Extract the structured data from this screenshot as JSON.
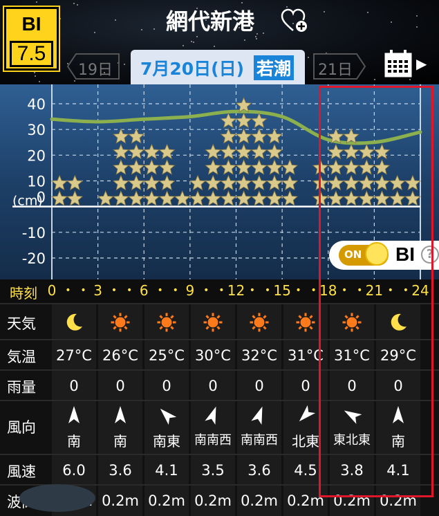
{
  "header": {
    "bi_label": "BI",
    "bi_value": "7.5",
    "title": "網代新港",
    "favorite_icon": "heart-plus-icon",
    "prev_day": "19日",
    "current_date": "7月20日(日)",
    "tide_type": "若潮",
    "next_day": "21日",
    "calendar_icon": "calendar-icon"
  },
  "chart_data": {
    "type": "line",
    "x": [
      0,
      3,
      6,
      9,
      12,
      15,
      18,
      21,
      24
    ],
    "series": [
      {
        "values": [
          34,
          33,
          34,
          35,
          37,
          35,
          26,
          25,
          29
        ]
      }
    ],
    "y_ticks": [
      "40",
      "30",
      "20",
      "10",
      "0",
      "-10",
      "-20"
    ],
    "y_unit": "(cm)",
    "ylim": [
      -25,
      45
    ],
    "xlim": [
      0,
      24
    ],
    "bi_stars": [
      2,
      2,
      0,
      1,
      5,
      5,
      4,
      4,
      1,
      2,
      4,
      6,
      7,
      6,
      5,
      3,
      0,
      3,
      5,
      5,
      4,
      4,
      2,
      2
    ],
    "grid": true
  },
  "bi_toggle": {
    "state": "ON",
    "label": "BI",
    "help": "?"
  },
  "hours": {
    "label": "時刻",
    "ticks": [
      "0",
      "3",
      "6",
      "9",
      "12",
      "15",
      "18",
      "21",
      "24"
    ]
  },
  "table": {
    "weather": {
      "label": "天気",
      "icons": [
        "moon",
        "sun",
        "sun",
        "sun",
        "sun",
        "sun",
        "sun",
        "moon"
      ]
    },
    "temp": {
      "label": "気温",
      "values": [
        "27°C",
        "26°C",
        "25°C",
        "30°C",
        "32°C",
        "31°C",
        "31°C",
        "29°C"
      ]
    },
    "rain": {
      "label": "雨量",
      "values": [
        "0",
        "0",
        "0",
        "0",
        "0",
        "0",
        "0",
        "0"
      ]
    },
    "wind_dir": {
      "label": "風向",
      "values": [
        "南",
        "南",
        "南東",
        "南南西",
        "南南西",
        "北東",
        "東北東",
        "南"
      ],
      "arrow_deg": [
        0,
        0,
        -45,
        20,
        20,
        -135,
        -60,
        0
      ]
    },
    "wind_speed": {
      "label": "風速",
      "values": [
        "6.0",
        "3.6",
        "4.1",
        "3.5",
        "3.6",
        "4.5",
        "3.8",
        "4.1"
      ]
    },
    "wave": {
      "label": "波高",
      "values": [
        "0.2m",
        "0.2m",
        "0.2m",
        "0.2m",
        "0.2m",
        "0.2m",
        "0.2m",
        "0.2m"
      ]
    }
  },
  "colors": {
    "accent": "#1a84d8",
    "hour_yellow": "#ffe24a",
    "star": "#d9c98a",
    "tide_line": "#8db04f",
    "highlight": "#e0162b"
  }
}
